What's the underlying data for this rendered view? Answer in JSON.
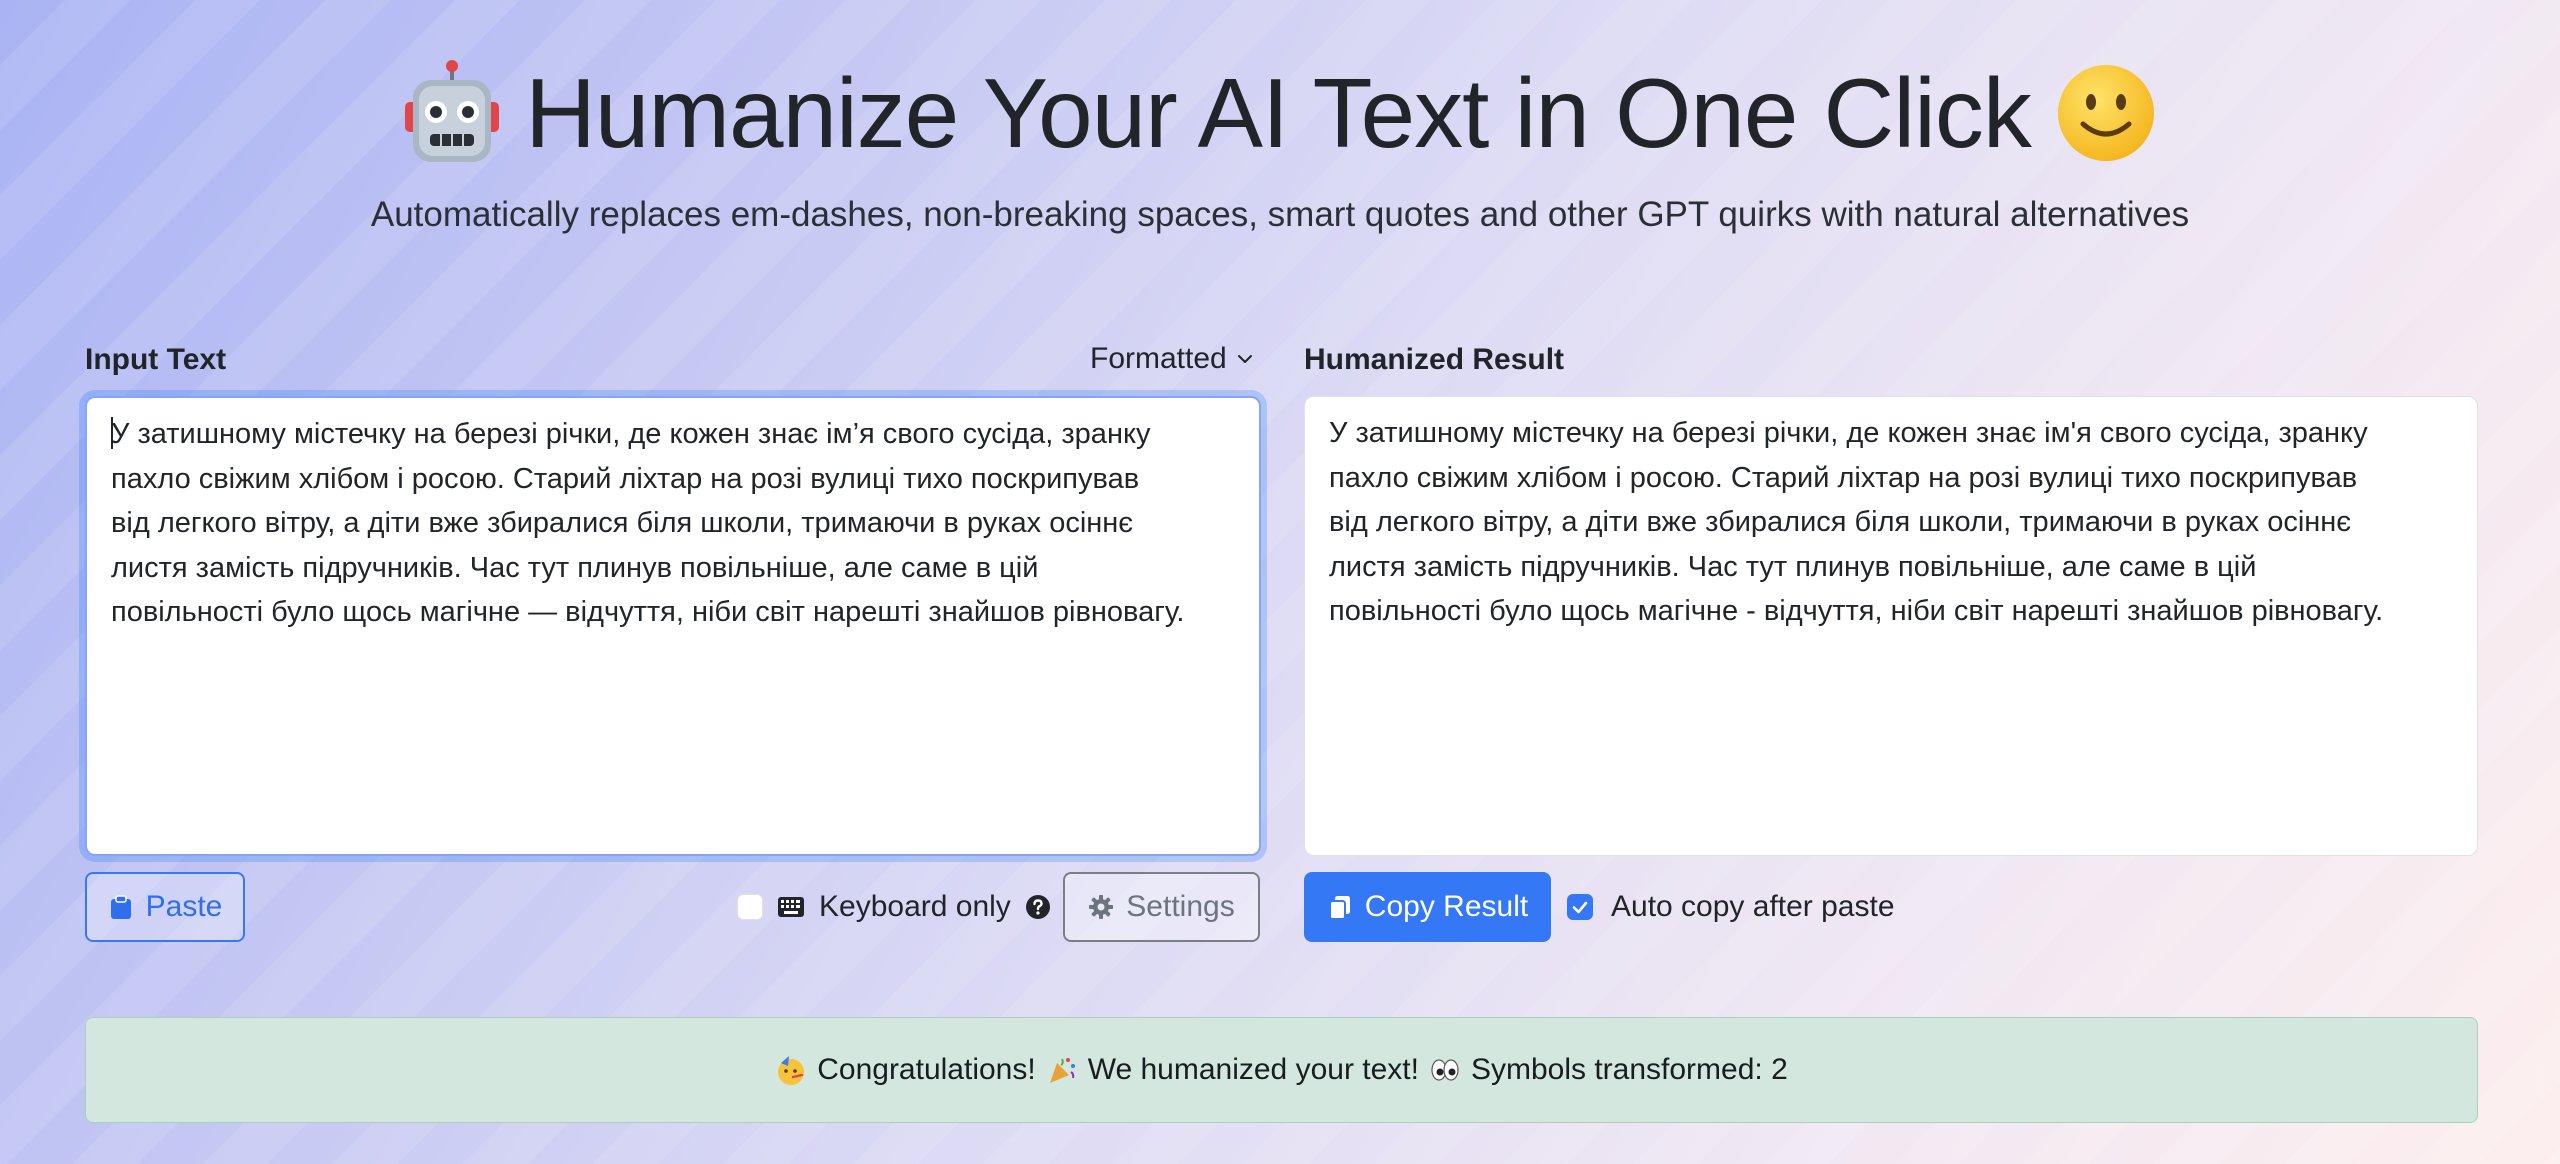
{
  "header": {
    "title": "Humanize Your AI Text in One Click",
    "subtitle": "Automatically replaces em-dashes, non-breaking spaces, smart quotes and other GPT quirks with natural alternatives",
    "left_icon": "robot-emoji",
    "right_icon": "slightly-smiling-face-emoji"
  },
  "input": {
    "label": "Input Text",
    "format_selected": "Formatted",
    "text": "У затишному містечку на березі річки, де кожен знає ім’я свого сусіда, зранку\nпахло свіжим хлібом і росою. Старий ліхтар на розі вулиці тихо поскрипував\nвід легкого вітру, а діти вже збиралися біля школи, тримаючи в руках осіннє\nлистя замість підручників. Час тут плинув повільніше, але саме в цій\nповільності було щось магічне — відчуття, ніби світ нарешті знайшов рівновагу."
  },
  "output": {
    "label": "Humanized Result",
    "text": "У затишному містечку на березі річки, де кожен знає ім'я свого сусіда, зранку\nпахло свіжим хлібом і росою. Старий ліхтар на розі вулиці тихо поскрипував\nвід легкого вітру, а діти вже збиралися біля школи, тримаючи в руках осіннє\nлистя замість підручників. Час тут плинув повільніше, але саме в цій\nповільності було щось магічне - відчуття, ніби світ нарешті знайшов рівновагу."
  },
  "controls": {
    "paste_label": "Paste",
    "keyboard_only_label": "Keyboard only",
    "keyboard_only_checked": false,
    "settings_label": "Settings",
    "copy_label": "Copy Result",
    "auto_copy_label": "Auto copy after paste",
    "auto_copy_checked": true
  },
  "alert": {
    "part1": "Congratulations!",
    "part2": "We humanized your text!",
    "part3": "Symbols transformed: 2"
  },
  "colors": {
    "primary": "#3478f6",
    "alert_bg": "#d3e7de",
    "secondary": "#6c757d"
  }
}
